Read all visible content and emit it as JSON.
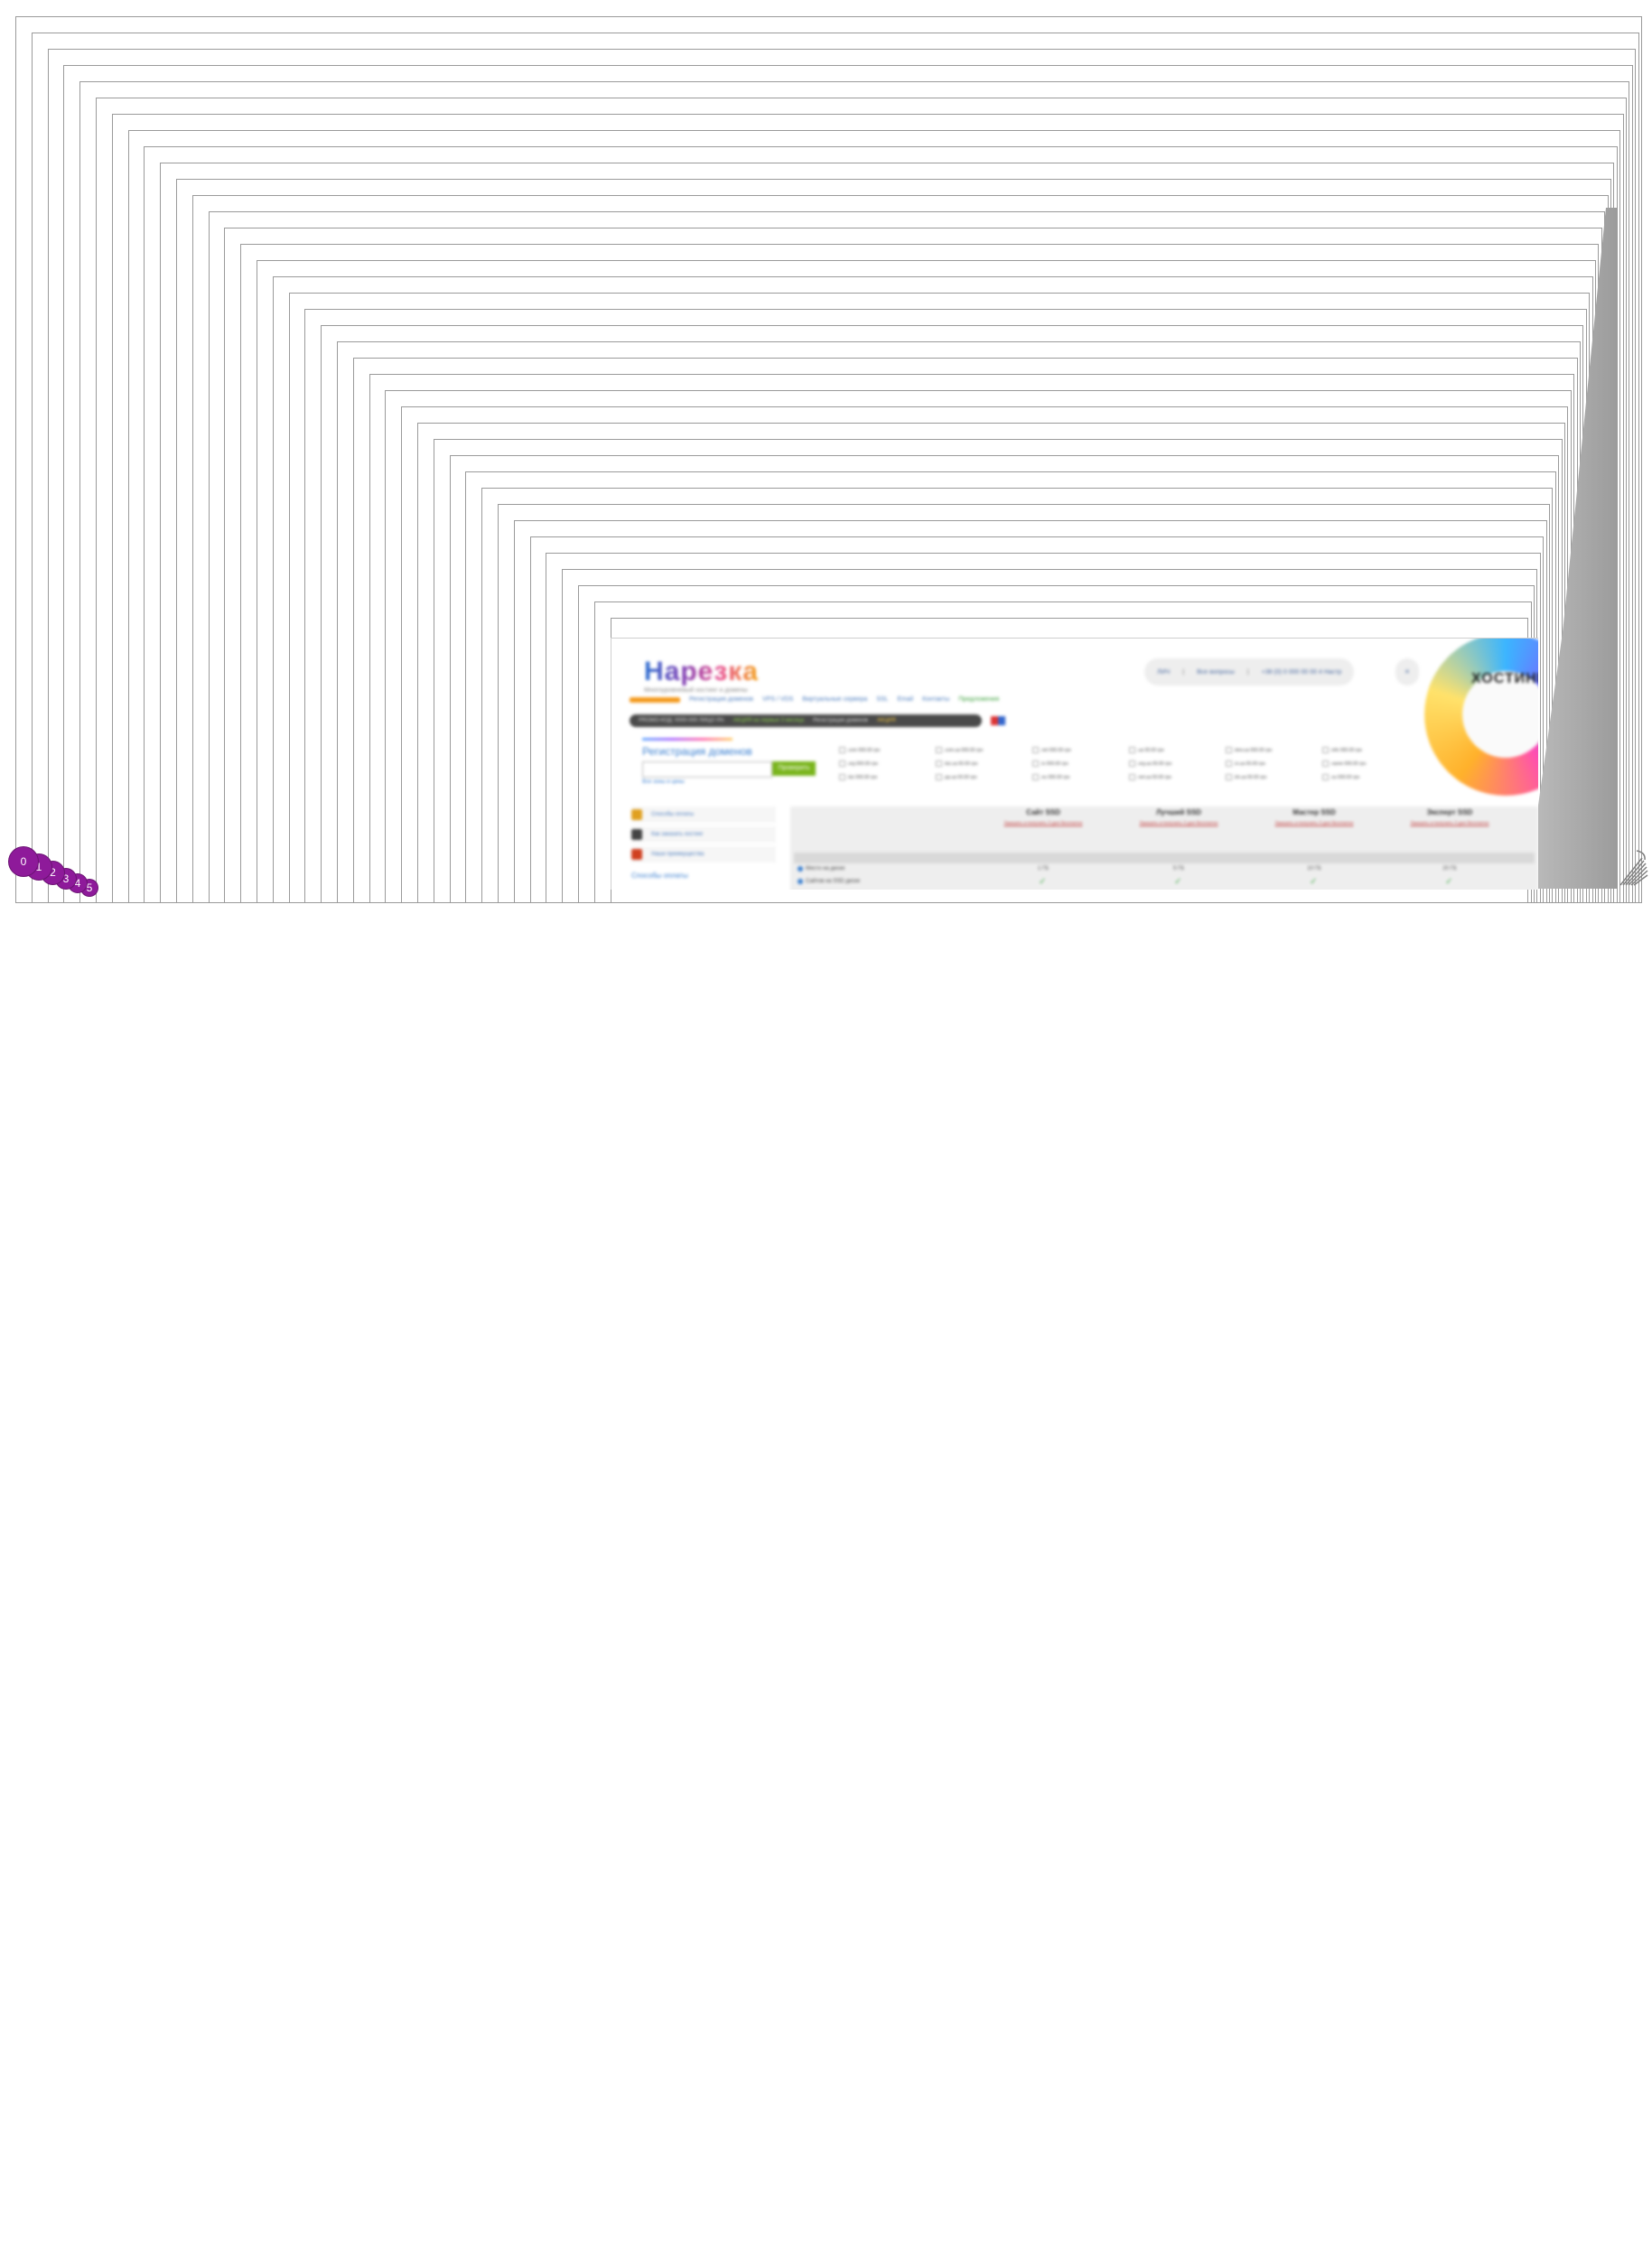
{
  "app": {
    "title": "Нарезка",
    "tagline": "Многоуровневый хостинг и домены"
  },
  "topbar": {
    "items": [
      "ЛИЧ",
      "Все вопросы",
      "+38 (0) 0 000 00 00 4 Настр"
    ],
    "close_label": "✕"
  },
  "nav": {
    "active_label": "",
    "items": [
      "Регистрация доменов",
      "VPS / VDS",
      "Виртуальные сервера",
      "SSL",
      "Email",
      "Контакты"
    ],
    "special_label": "Предложения"
  },
  "promo": {
    "parts": [
      "PROMO-КОД: 0000-000 ЛИЦО 0%",
      "АКЦИЯ на первые 3 месяца",
      "Регистрация доменов"
    ],
    "cta": "АКЦИЯ"
  },
  "domain_reg": {
    "title": "Регистрация доменов",
    "button_label": "Проверить",
    "link_label": "Все зоны и цены"
  },
  "tlds": [
    ".com 000.00 грн",
    ".com.ua 000.00 грн",
    ".net 000.00 грн",
    ".ua 00.00 грн",
    ".kiev.ua 000.00 грн",
    ".info 000.00 грн",
    ".org 000.00 грн",
    ".biz.ua 00.00 грн",
    ".tv 000.00 грн",
    ".org.ua 00.00 грн",
    ".in.ua 00.00 грн",
    ".name 000.00 грн",
    ".biz 000.00 грн",
    ".pp.ua 00.00 грн",
    ".eu 000.00 грн",
    ".net.ua 00.00 грн",
    ".kh.ua 00.00 грн",
    ".su 000.00 грн"
  ],
  "banner": {
    "text": "ХОСТИНГ"
  },
  "sidebar": {
    "items": [
      "Способы оплаты",
      "Как заказать хостинг",
      "Наши преимущества"
    ],
    "heading": "Способы оплаты",
    "icon_colors": [
      "#e0a020",
      "#444444",
      "#d04020"
    ]
  },
  "plans": {
    "columns": [
      {
        "name": "Сайт SSD",
        "link": "Заказать и получить 3 дня бесплатно"
      },
      {
        "name": "Лучший SSD",
        "link": "Заказать и получить 3 дня бесплатно"
      },
      {
        "name": "Мастер SSD",
        "link": "Заказать и получить 3 дня бесплатно"
      },
      {
        "name": "Эксперт SSD",
        "link": "Заказать и получить 3 дня бесплатно"
      }
    ],
    "rows": [
      {
        "label": "Место на диске",
        "values": [
          "1 ГБ",
          "5 ГБ",
          "10 ГБ",
          "20 ГБ"
        ]
      },
      {
        "label": "Сайтов на SSD диске",
        "values": [
          "✓",
          "✓",
          "✓",
          "✓"
        ]
      }
    ]
  },
  "markers": [
    "0",
    "1",
    "2",
    "3",
    "4",
    "5"
  ],
  "colors": {
    "frame_border": "#9a9a9a",
    "marker": "#8e1a9a",
    "accent_orange": "#f49a1c",
    "accent_green": "#7ab51d",
    "link_blue": "#3a7fd0"
  }
}
